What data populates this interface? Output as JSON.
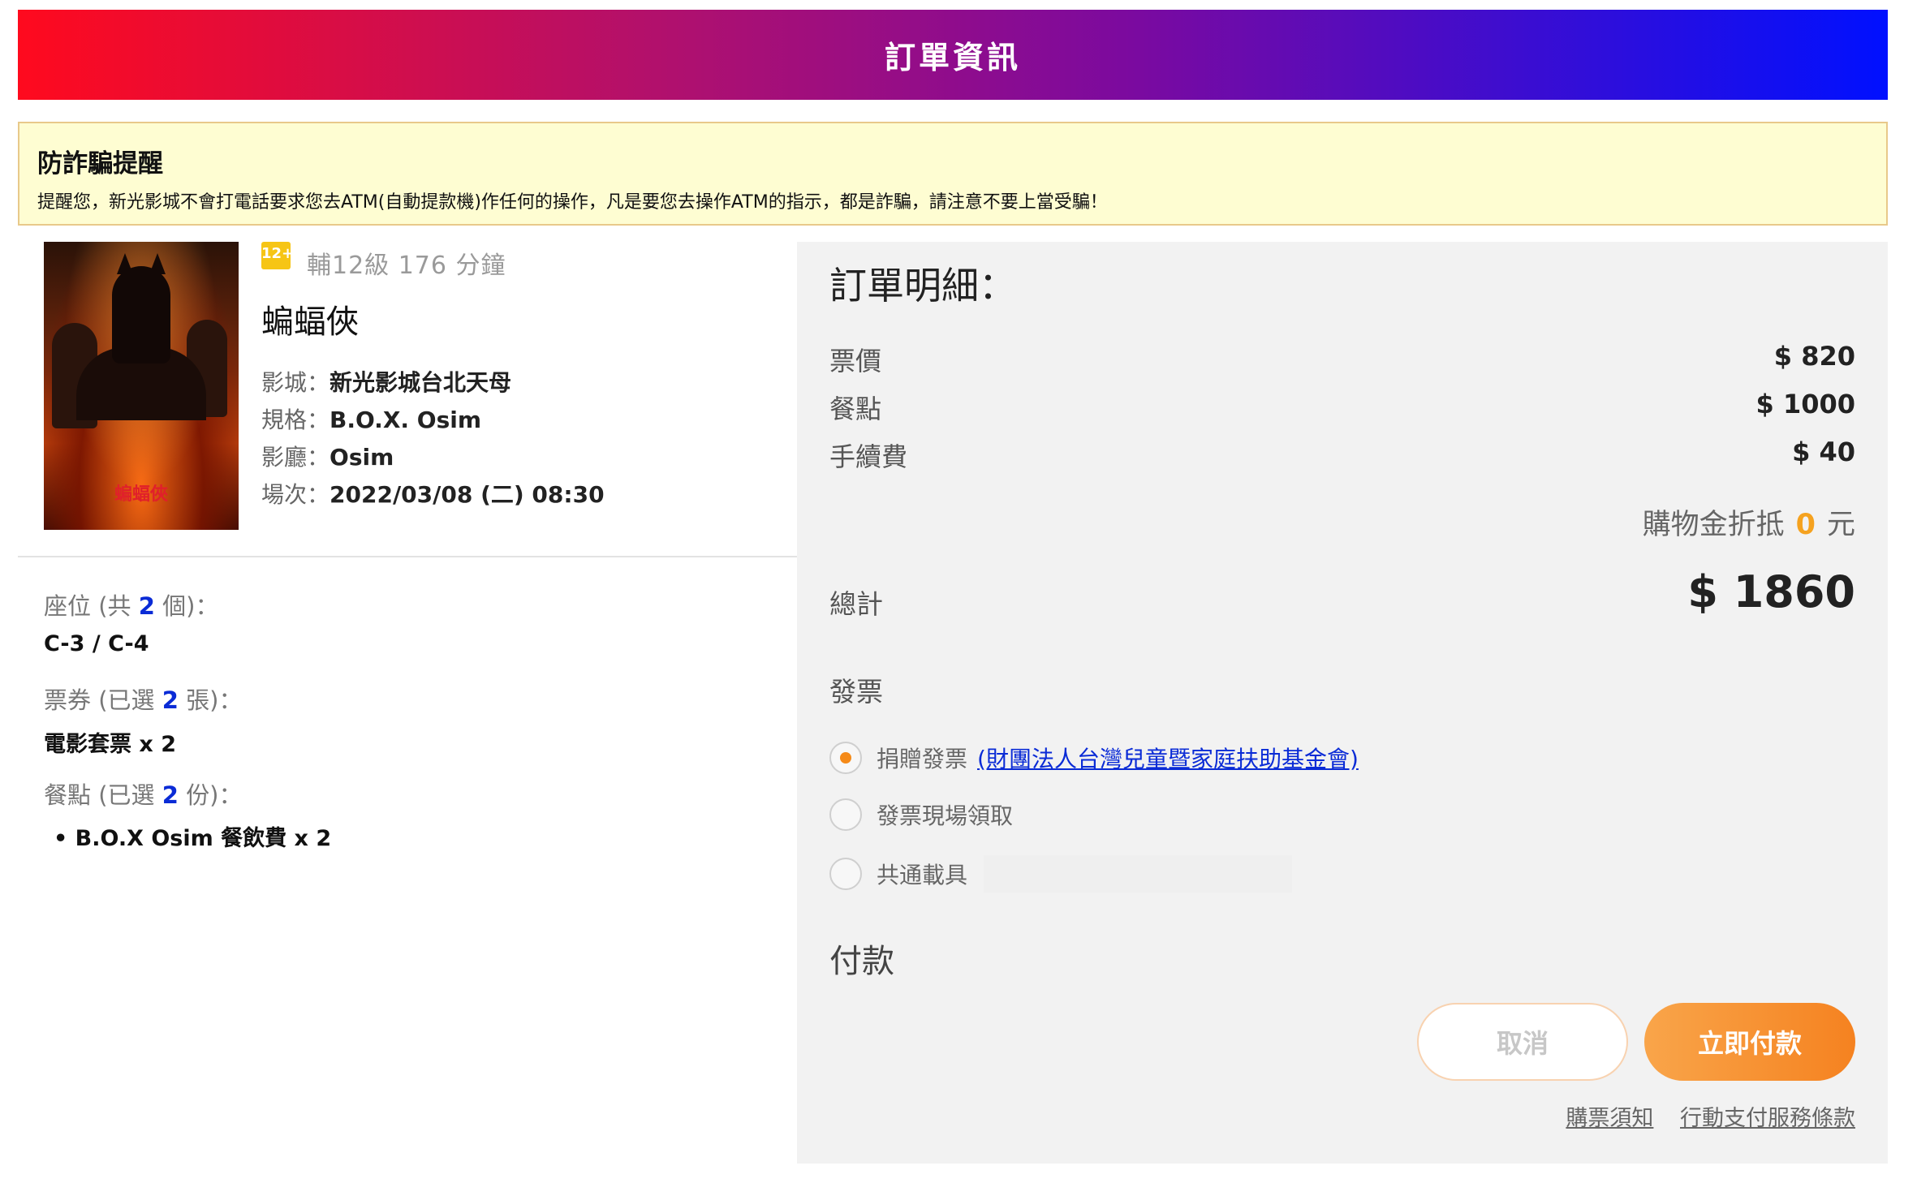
{
  "header": {
    "title": "訂單資訊"
  },
  "warning": {
    "title": "防詐騙提醒",
    "text": "提醒您，新光影城不會打電話要求您去ATM(自動提款機)作任何的操作，凡是要您去操作ATM的指示，都是詐騙，請注意不要上當受騙！"
  },
  "movie": {
    "poster_title": "蝙蝠俠",
    "rating_badge": "12+",
    "rating_duration": "輔12級 176 分鐘",
    "title": "蝙蝠俠",
    "cinema_label": "影城：",
    "cinema": "新光影城台北天母",
    "format_label": "規格：",
    "format": "B.O.X. Osim",
    "hall_label": "影廳：",
    "hall": "Osim",
    "showtime_label": "場次：",
    "showtime": "2022/03/08 (二) 08:30"
  },
  "seats": {
    "label_prefix": "座位 (共 ",
    "count": "2",
    "label_suffix": " 個)：",
    "value": "C-3 / C-4"
  },
  "tickets": {
    "label_prefix": "票券 (已選 ",
    "count": "2",
    "label_suffix": " 張)：",
    "value": "電影套票 x 2"
  },
  "meals": {
    "label_prefix": "餐點 (已選 ",
    "count": "2",
    "label_suffix": " 份)：",
    "items": [
      "B.O.X Osim 餐飲費 x 2"
    ]
  },
  "order": {
    "title": "訂單明細：",
    "fees": [
      {
        "label": "票價",
        "value": "$ 820"
      },
      {
        "label": "餐點",
        "value": "$ 1000"
      },
      {
        "label": "手續費",
        "value": "$ 40"
      }
    ],
    "credit_label": "購物金折抵",
    "credit_amount": "0",
    "credit_unit": "元",
    "total_label": "總計",
    "total_value": "$ 1860",
    "invoice_label": "發票",
    "invoice_options": [
      {
        "label": "捐贈發票",
        "link": "(財團法人台灣兒童暨家庭扶助基金會)",
        "checked": true
      },
      {
        "label": "發票現場領取",
        "checked": false
      },
      {
        "label": "共通載具",
        "checked": false
      }
    ],
    "payment_label": "付款",
    "cancel_label": "取消",
    "pay_label": "立即付款",
    "links": [
      "購票須知",
      "行動支付服務條款"
    ]
  },
  "colors": {
    "accent": "#f58a18",
    "count_blue": "#0a2bd6",
    "warning_bg": "#fefdd2"
  }
}
